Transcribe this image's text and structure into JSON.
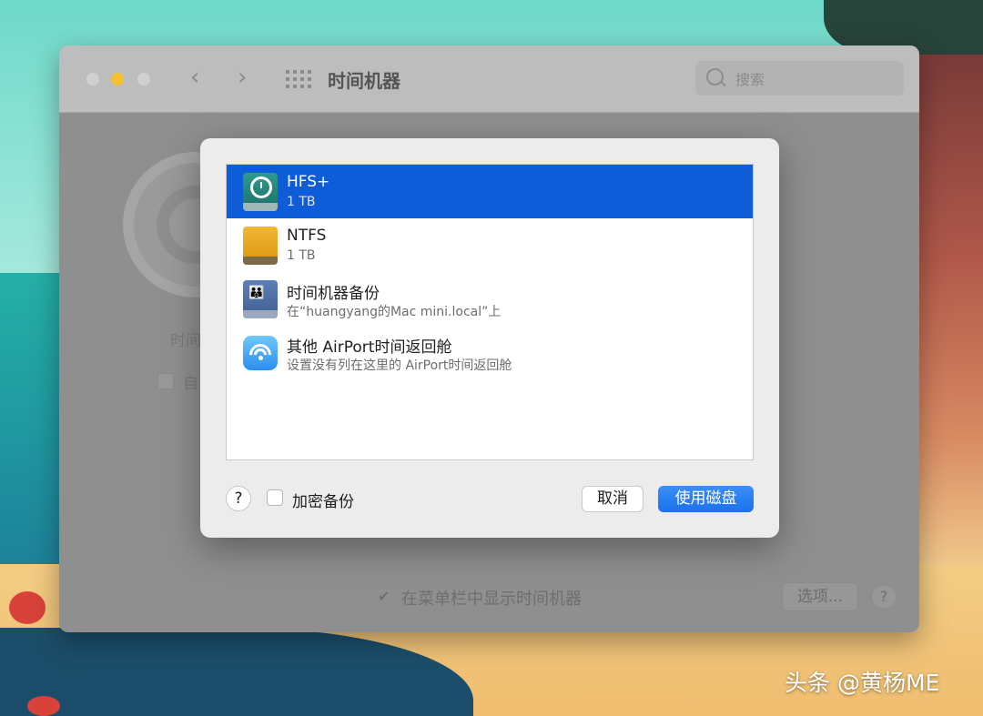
{
  "window": {
    "title": "时间机器",
    "search_placeholder": "搜索",
    "back_icon": "chevron-left-icon",
    "forward_icon": "chevron-right-icon",
    "background_label": "时间",
    "auto_backup_label": "自",
    "show_in_menubar_label": "在菜单栏中显示时间机器",
    "options_label": "选项...",
    "help_label": "?"
  },
  "sheet": {
    "disks": [
      {
        "name": "HFS+",
        "detail": "1 TB",
        "icon": "time-machine-disk-icon",
        "selected": true
      },
      {
        "name": "NTFS",
        "detail": "1 TB",
        "icon": "external-drive-icon",
        "selected": false
      },
      {
        "name": "时间机器备份",
        "detail": "在“huangyang的Mac mini.local”上",
        "icon": "network-drive-icon",
        "selected": false
      },
      {
        "name": "其他 AirPort时间返回舱",
        "detail": "设置没有列在这里的 AirPort时间返回舱",
        "icon": "airport-wifi-icon",
        "selected": false
      }
    ],
    "help_label": "?",
    "encrypt_label": "加密备份",
    "encrypt_checked": false,
    "cancel_label": "取消",
    "use_disk_label": "使用磁盘",
    "accent_color": "#0e5cd8"
  },
  "watermark": "头条 @黄杨ME"
}
